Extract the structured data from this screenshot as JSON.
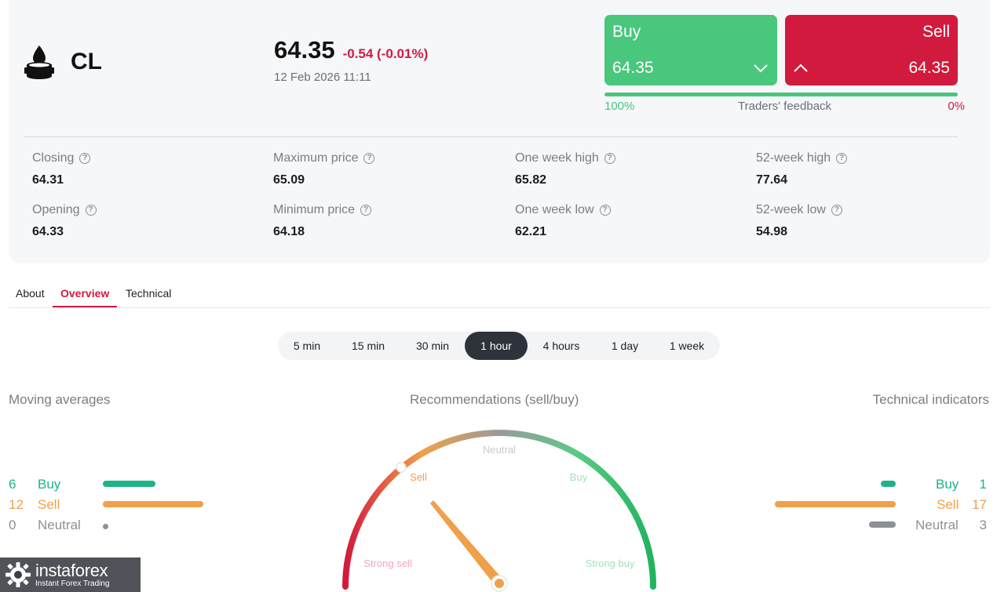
{
  "instrument": {
    "symbol": "CL",
    "icon": "oil-drop-icon"
  },
  "quote": {
    "price": "64.35",
    "change": "-0.54 (-0.01%)",
    "datetime": "12 Feb 2026 11:11"
  },
  "trade": {
    "buy_label": "Buy",
    "buy_price": "64.35",
    "sell_label": "Sell",
    "sell_price": "64.35"
  },
  "feedback": {
    "buy_pct": "100%",
    "label": "Traders' feedback",
    "sell_pct": "0%",
    "buy_share": 1.0
  },
  "stats": {
    "closing": {
      "label": "Closing",
      "value": "64.31"
    },
    "opening": {
      "label": "Opening",
      "value": "64.33"
    },
    "max_price": {
      "label": "Maximum price",
      "value": "65.09"
    },
    "min_price": {
      "label": "Minimum price",
      "value": "64.18"
    },
    "week_high": {
      "label": "One week high",
      "value": "65.82"
    },
    "week_low": {
      "label": "One week low",
      "value": "62.21"
    },
    "high_52": {
      "label": "52-week high",
      "value": "77.64"
    },
    "low_52": {
      "label": "52-week low",
      "value": "54.98"
    }
  },
  "tabs": {
    "about": "About",
    "overview": "Overview",
    "technical": "Technical"
  },
  "timeframes": {
    "tf_5min": "5 min",
    "tf_15min": "15 min",
    "tf_30min": "30 min",
    "tf_1hour": "1 hour",
    "tf_4hours": "4 hours",
    "tf_1day": "1 day",
    "tf_1week": "1 week",
    "active": "1 hour"
  },
  "moving_averages": {
    "title": "Moving averages",
    "buy": {
      "count": "6",
      "label": "Buy"
    },
    "sell": {
      "count": "12",
      "label": "Sell"
    },
    "neutral": {
      "count": "0",
      "label": "Neutral"
    }
  },
  "recommendations": {
    "title": "Recommendations (sell/buy)",
    "neutral": "Neutral",
    "sell": "Sell",
    "buy": "Buy",
    "strong_sell": "Strong sell",
    "strong_buy": "Strong buy",
    "current": "Sell"
  },
  "technical_indicators": {
    "title": "Technical indicators",
    "buy": {
      "count": "1",
      "label": "Buy"
    },
    "sell": {
      "count": "17",
      "label": "Sell"
    },
    "neutral": {
      "count": "3",
      "label": "Neutral"
    }
  },
  "colors": {
    "buy": "#49c77d",
    "sell": "#d21a3e",
    "ma_buy": "#1fb38a",
    "ma_sell": "#f0a04b",
    "neutral": "#8d9097"
  },
  "watermark": {
    "brand": "instaforex",
    "tagline": "Instant Forex Trading"
  }
}
